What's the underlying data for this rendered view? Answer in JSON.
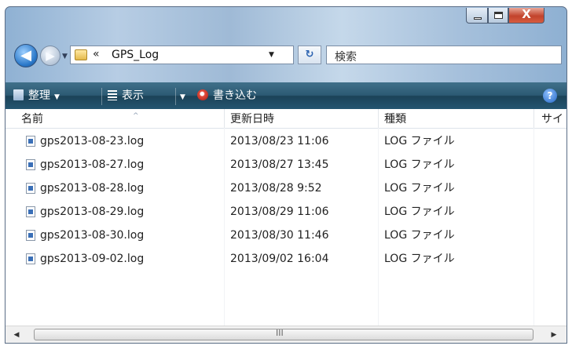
{
  "window": {
    "min_glyph": "",
    "max_glyph": "",
    "close_glyph": "X"
  },
  "nav": {
    "back_arrow": "◀",
    "forward_arrow": "▶",
    "history_caret": "▼"
  },
  "address": {
    "chevron": "«",
    "path": "GPS_Log",
    "dropdown": "▼",
    "refresh": "↻"
  },
  "search": {
    "placeholder": "検索"
  },
  "toolbar": {
    "organize_label": "整理",
    "view_label": "表示",
    "burn_label": "書き込む",
    "help_label": "?",
    "caret": "▼",
    "view_split_caret": "▼"
  },
  "columns": [
    {
      "label": "名前"
    },
    {
      "label": "更新日時"
    },
    {
      "label": "種類"
    },
    {
      "label": "サイ"
    }
  ],
  "sort_indicator": "^",
  "files": [
    {
      "name": "gps2013-08-23.log",
      "modified": "2013/08/23 11:06",
      "type": "LOG ファイル"
    },
    {
      "name": "gps2013-08-27.log",
      "modified": "2013/08/27 13:45",
      "type": "LOG ファイル"
    },
    {
      "name": "gps2013-08-28.log",
      "modified": "2013/08/28 9:52",
      "type": "LOG ファイル"
    },
    {
      "name": "gps2013-08-29.log",
      "modified": "2013/08/29 11:06",
      "type": "LOG ファイル"
    },
    {
      "name": "gps2013-08-30.log",
      "modified": "2013/08/30 11:46",
      "type": "LOG ファイル"
    },
    {
      "name": "gps2013-09-02.log",
      "modified": "2013/09/02 16:04",
      "type": "LOG ファイル"
    }
  ],
  "scrollbar": {
    "left": "◀",
    "right": "▶",
    "grip": "III"
  },
  "colors": {
    "toolbar": "#2c5a73",
    "titlebar": "#a7c1dc",
    "close_button": "#c2432c"
  },
  "icons": [
    "folder-icon",
    "refresh-icon",
    "organize-icon",
    "view-icon",
    "burn-icon",
    "help-icon",
    "log-file-icon"
  ]
}
